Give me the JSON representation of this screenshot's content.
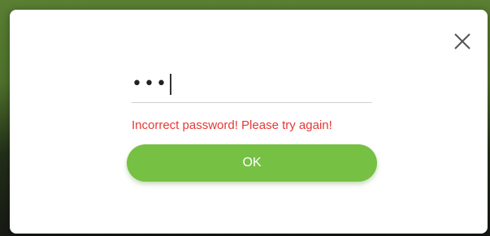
{
  "password_field": {
    "masked_value": "•••"
  },
  "error": {
    "message": "Incorrect password! Please try again!"
  },
  "actions": {
    "ok_label": "OK"
  },
  "colors": {
    "accent_green": "#76c044",
    "error_red": "#e53935",
    "close_icon": "#555555"
  }
}
